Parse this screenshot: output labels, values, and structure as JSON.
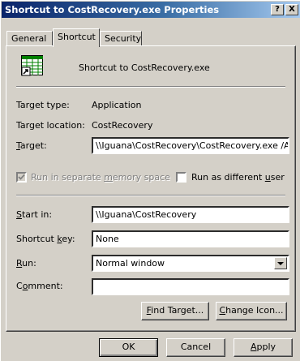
{
  "window": {
    "title": "Shortcut to CostRecovery.exe Properties",
    "help_button": "?",
    "close_button": "X"
  },
  "tabs": [
    {
      "label": "General",
      "active": false
    },
    {
      "label": "Shortcut",
      "active": true
    },
    {
      "label": "Security",
      "active": false
    }
  ],
  "header": {
    "icon": "spreadsheet-shortcut-icon",
    "name": "Shortcut to CostRecovery.exe"
  },
  "fields": {
    "target_type_label": "Target type:",
    "target_type_value": "Application",
    "target_location_label": "Target location:",
    "target_location_value": "CostRecovery",
    "target_label_first": "T",
    "target_label_rest": "arget:",
    "target_value": "\\\\Iguana\\CostRecovery\\CostRecovery.exe /Auto",
    "run_separate_memory_pre": "Run in separate ",
    "run_separate_memory_u": "m",
    "run_separate_memory_post": "emory space",
    "run_separate_memory_checked": true,
    "run_as_different_user_pre": "Run as different ",
    "run_as_different_user_u": "u",
    "run_as_different_user_post": "ser",
    "run_as_different_user_checked": false,
    "start_in_label_first": "S",
    "start_in_label_rest": "tart in:",
    "start_in_value": "\\\\Iguana\\CostRecovery",
    "shortcut_key_label_pre": "Shortcut ",
    "shortcut_key_label_u": "k",
    "shortcut_key_label_post": "ey:",
    "shortcut_key_value": "None",
    "run_label_first": "R",
    "run_label_rest": "un:",
    "run_value": "Normal window",
    "comment_label_first": "C",
    "comment_label_u": "o",
    "comment_label_rest": "mment:",
    "comment_value": ""
  },
  "buttons": {
    "find_target_u": "F",
    "find_target_rest": "ind Target...",
    "change_icon_u": "C",
    "change_icon_rest": "hange Icon...",
    "ok": "OK",
    "cancel": "Cancel",
    "apply_u": "A",
    "apply_rest": "pply"
  }
}
